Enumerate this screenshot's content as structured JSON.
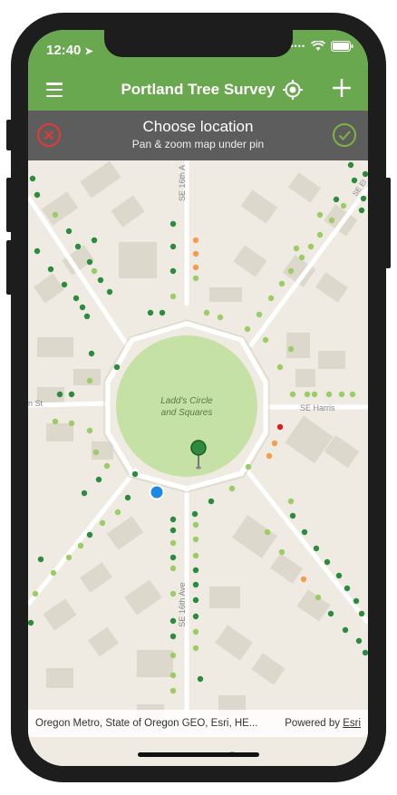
{
  "status_bar": {
    "time": "12:40",
    "signal_icon": "signal-dots-icon",
    "wifi_icon": "wifi-icon",
    "battery_icon": "battery-icon"
  },
  "nav": {
    "title": "Portland Tree Survey",
    "menu_icon": "hamburger-icon",
    "locate_icon": "locate-icon",
    "add_icon": "plus-icon"
  },
  "choose_location": {
    "title": "Choose location",
    "subtitle": "Pan & zoom map under pin",
    "cancel_icon": "cancel-x-icon",
    "confirm_icon": "confirm-check-icon"
  },
  "map": {
    "park_label_line1": "Ladd's Circle",
    "park_label_line2": "and Squares",
    "street_north": "SE 16th A",
    "street_south": "SE 16th Ave",
    "street_west": "n St",
    "street_east": "SE Harris",
    "street_ne": "SE El"
  },
  "attribution": {
    "text": "Oregon Metro, State of Oregon GEO, Esri, HE...",
    "powered_by": "Powered by",
    "esri": "Esri"
  },
  "colors": {
    "nav_green": "#6aa84f",
    "tree_dark": "#2e8b3e",
    "tree_light": "#9ccc65",
    "tree_orange": "#f0a050",
    "tree_red": "#d62020",
    "location_blue": "#1e88e5"
  }
}
